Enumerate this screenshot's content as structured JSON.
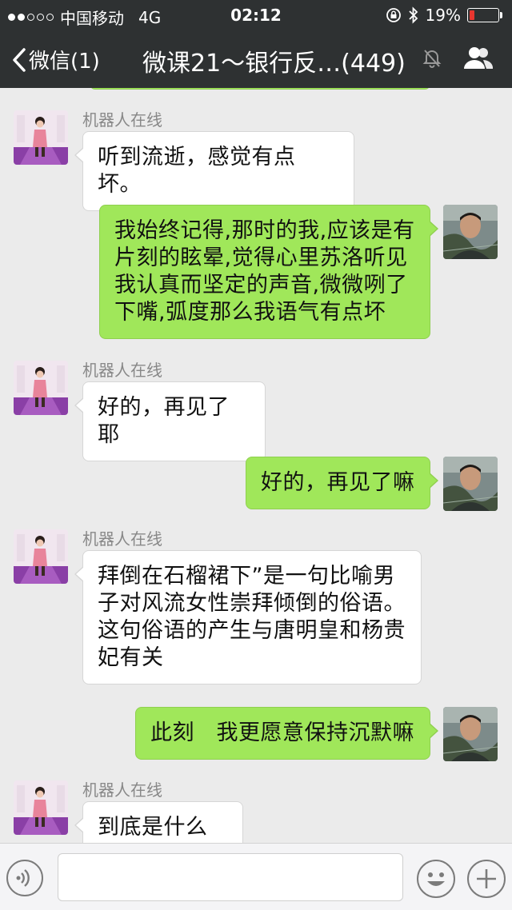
{
  "status_bar": {
    "carrier": "中国移动",
    "network": "4G",
    "time": "02:12",
    "battery": "19%",
    "battery_level": 0.19,
    "signal_bars_filled": 2,
    "signal_bars_total": 5
  },
  "nav": {
    "back_label": "微信(1)",
    "title": "微课21～银行反…(449)",
    "icons": [
      "chevron-left-icon",
      "mute-icon",
      "contacts-icon"
    ]
  },
  "messages": [
    {
      "direction": "in",
      "sender": "机器人在线",
      "lines": [
        "听到流逝，感觉有点坏。"
      ]
    },
    {
      "direction": "out",
      "lines": [
        "我始终记得,那时的我,应该是有",
        "片刻的眩晕,觉得心里苏洛听见",
        "我认真而坚定的声音,微微咧了",
        "下嘴,弧度那么我语气有点坏"
      ]
    },
    {
      "direction": "in",
      "sender": "机器人在线",
      "lines": [
        "好的，再见了耶"
      ]
    },
    {
      "direction": "out",
      "lines": [
        "好的，再见了嘛"
      ]
    },
    {
      "direction": "in",
      "sender": "机器人在线",
      "lines": [
        "拜倒在石榴裙下”是一句比喻男",
        "子对风流女性崇拜倾倒的俗语。",
        "这句俗语的产生与唐明皇和杨贵",
        "妃有关"
      ]
    },
    {
      "direction": "out",
      "lines": [
        "此刻　我更愿意保持沉默嘛"
      ]
    },
    {
      "direction": "in",
      "sender": "机器人在线",
      "lines": [
        "到底是什么呢"
      ]
    }
  ],
  "input": {
    "value": "",
    "icons": [
      "voice-icon",
      "emoji-icon",
      "plus-icon"
    ]
  },
  "colors": {
    "header": "#2e3132",
    "outgoing_bubble": "#a0e75a",
    "incoming_bubble": "#ffffff",
    "background": "#ebebeb",
    "battery_low": "#e8362f"
  }
}
